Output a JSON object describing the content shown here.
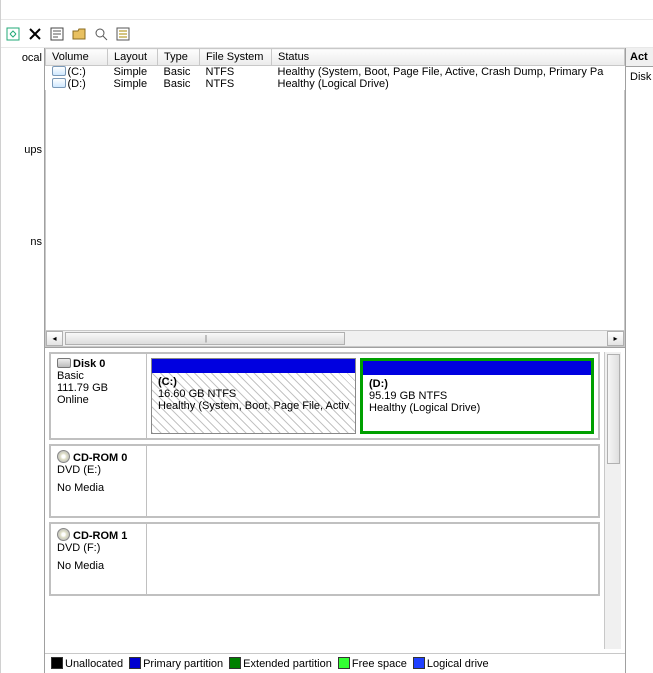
{
  "left": {
    "items": [
      "ocal",
      "ups",
      "ns"
    ]
  },
  "right": {
    "header": "Act",
    "row1": "Disk"
  },
  "columns": [
    "Volume",
    "Layout",
    "Type",
    "File System",
    "Status"
  ],
  "volumes": [
    {
      "name": "(C:)",
      "layout": "Simple",
      "type": "Basic",
      "fs": "NTFS",
      "status": "Healthy (System, Boot, Page File, Active, Crash Dump, Primary Pa"
    },
    {
      "name": "(D:)",
      "layout": "Simple",
      "type": "Basic",
      "fs": "NTFS",
      "status": "Healthy (Logical Drive)"
    }
  ],
  "disk0": {
    "title": "Disk 0",
    "type": "Basic",
    "size": "111.79 GB",
    "state": "Online",
    "partC": {
      "name": "(C:)",
      "size": "16.60 GB NTFS",
      "status": "Healthy (System, Boot, Page File, Activ"
    },
    "partD": {
      "name": "(D:)",
      "size": "95.19 GB NTFS",
      "status": "Healthy (Logical Drive)"
    }
  },
  "cd0": {
    "title": "CD-ROM 0",
    "mount": "DVD (E:)",
    "status": "No Media"
  },
  "cd1": {
    "title": "CD-ROM 1",
    "mount": "DVD (F:)",
    "status": "No Media"
  },
  "legend": {
    "unallocated": "Unallocated",
    "primary": "Primary partition",
    "extended": "Extended partition",
    "free": "Free space",
    "logical": "Logical drive"
  }
}
